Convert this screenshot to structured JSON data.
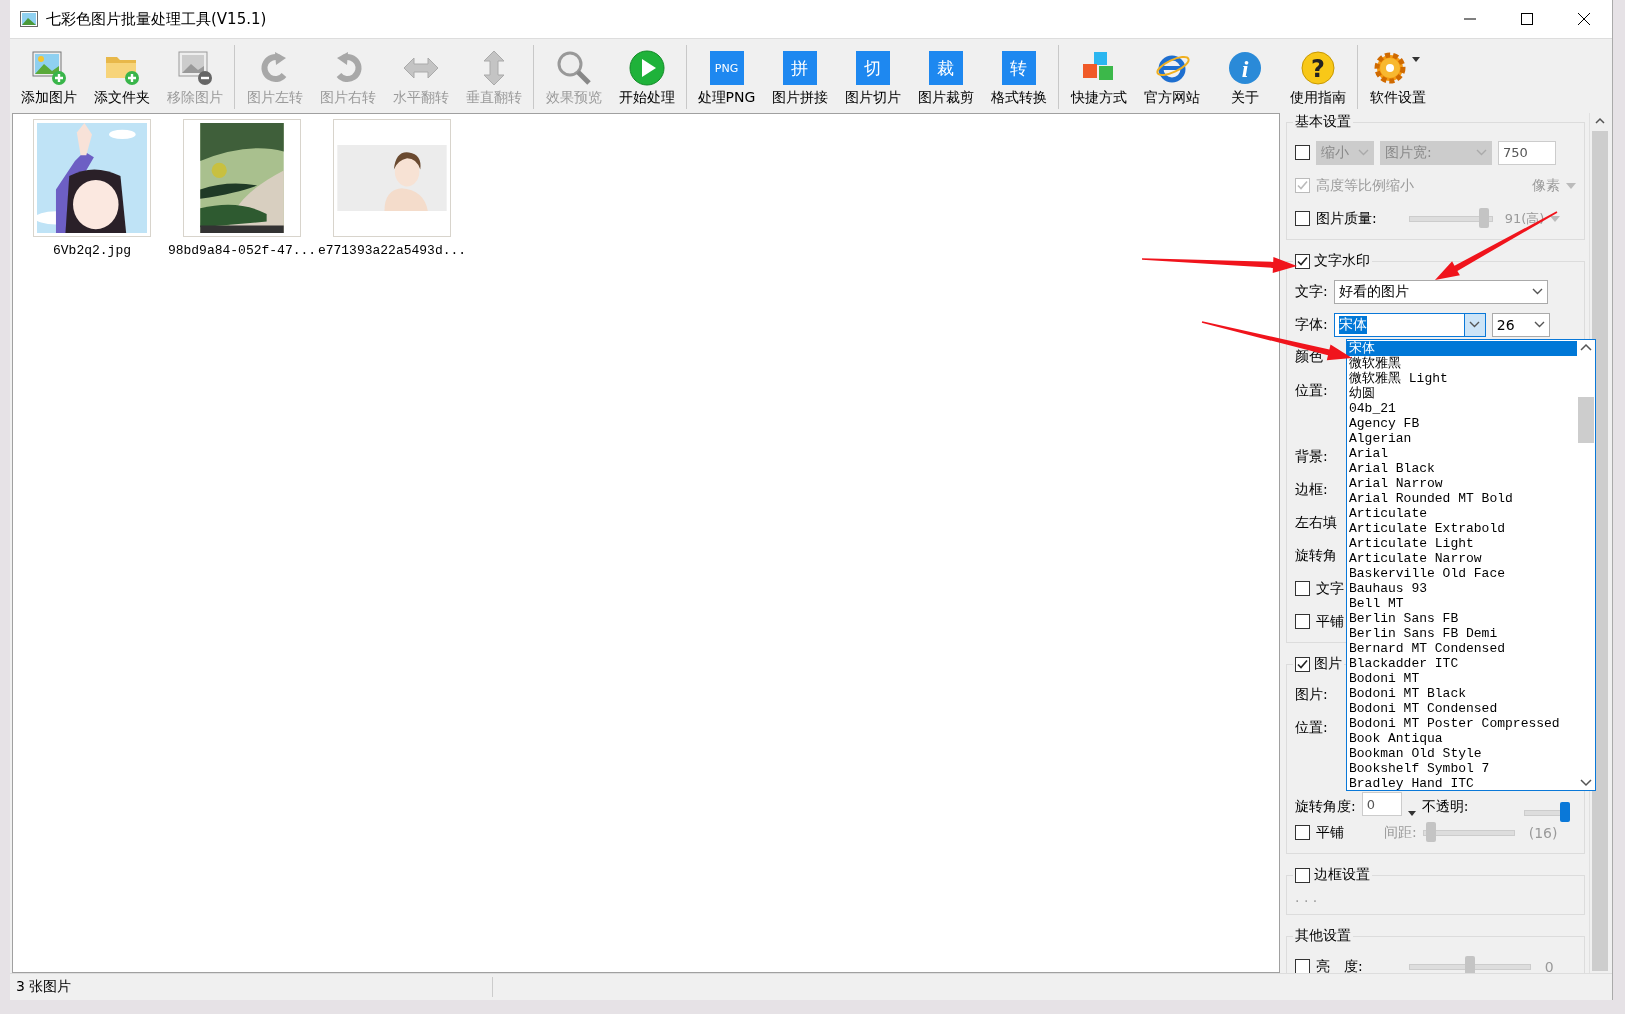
{
  "window": {
    "title": "七彩色图片批量处理工具(V15.1)"
  },
  "toolbar": {
    "groups": [
      {
        "items": [
          {
            "label": "添加图片",
            "disabled": false
          },
          {
            "label": "添文件夹",
            "disabled": false
          },
          {
            "label": "移除图片",
            "disabled": true
          }
        ]
      },
      {
        "items": [
          {
            "label": "图片左转",
            "disabled": true
          },
          {
            "label": "图片右转",
            "disabled": true
          },
          {
            "label": "水平翻转",
            "disabled": true
          },
          {
            "label": "垂直翻转",
            "disabled": true
          }
        ]
      },
      {
        "items": [
          {
            "label": "效果预览",
            "disabled": true
          },
          {
            "label": "开始处理",
            "disabled": false
          }
        ]
      },
      {
        "items": [
          {
            "label": "处理PNG",
            "badge": "PNG",
            "disabled": false
          },
          {
            "label": "图片拼接",
            "badge": "拼",
            "disabled": false
          },
          {
            "label": "图片切片",
            "badge": "切",
            "disabled": false
          },
          {
            "label": "图片裁剪",
            "badge": "裁",
            "disabled": false
          },
          {
            "label": "格式转换",
            "badge": "转",
            "disabled": false
          }
        ]
      },
      {
        "items": [
          {
            "label": "快捷方式",
            "disabled": false
          },
          {
            "label": "官方网站",
            "disabled": false
          },
          {
            "label": "关于",
            "glyph": "i",
            "disabled": false
          },
          {
            "label": "使用指南",
            "glyph": "?",
            "disabled": false
          }
        ]
      },
      {
        "items": [
          {
            "label": "软件设置",
            "disabled": false
          }
        ]
      }
    ]
  },
  "images": [
    {
      "kind": "picture",
      "caption": "6Vb2q2.jpg"
    },
    {
      "kind": "picture",
      "caption": "98bd9a84-052f-47..."
    },
    {
      "kind": "picture",
      "caption": "e771393a22a5493d..."
    }
  ],
  "settings": {
    "basic": {
      "title": "基本设置",
      "resize": {
        "checked": false,
        "mode": "缩小",
        "dimension": "图片宽:",
        "value": "750"
      },
      "keep_ratio": {
        "label": "高度等比例缩小",
        "checked": true,
        "unit": "像素"
      },
      "quality": {
        "label": "图片质量:",
        "checked": false,
        "level": 0.9,
        "reading": "91(高)"
      }
    },
    "text_watermark": {
      "label": "文字水印",
      "checked": true,
      "text_label": "文字:",
      "text_value": "好看的图片",
      "font_label": "字体:",
      "font_value": "宋体",
      "size_value": "26",
      "labels": [
        "颜色",
        "位置:",
        "背景:",
        "边框:",
        "左右填",
        "旋转角"
      ],
      "options": [
        {
          "label": "文字",
          "checked": false
        },
        {
          "label": "平铺",
          "checked": false
        }
      ],
      "font_list": [
        {
          "label": "宋体",
          "selected": true
        },
        {
          "label": "微软雅黑",
          "selected": false
        },
        {
          "label": "微软雅黑 Light",
          "selected": false
        },
        {
          "label": "幼圆",
          "selected": false
        },
        {
          "label": "04b_21",
          "selected": false
        },
        {
          "label": "Agency FB",
          "selected": false
        },
        {
          "label": "Algerian",
          "selected": false
        },
        {
          "label": "Arial",
          "selected": false
        },
        {
          "label": "Arial Black",
          "selected": false
        },
        {
          "label": "Arial Narrow",
          "selected": false
        },
        {
          "label": "Arial Rounded MT Bold",
          "selected": false
        },
        {
          "label": "Articulate",
          "selected": false
        },
        {
          "label": "Articulate Extrabold",
          "selected": false
        },
        {
          "label": "Articulate Light",
          "selected": false
        },
        {
          "label": "Articulate Narrow",
          "selected": false
        },
        {
          "label": "Baskerville Old Face",
          "selected": false
        },
        {
          "label": "Bauhaus 93",
          "selected": false
        },
        {
          "label": "Bell MT",
          "selected": false
        },
        {
          "label": "Berlin Sans FB",
          "selected": false
        },
        {
          "label": "Berlin Sans FB Demi",
          "selected": false
        },
        {
          "label": "Bernard MT Condensed",
          "selected": false
        },
        {
          "label": "Blackadder ITC",
          "selected": false
        },
        {
          "label": "Bodoni MT",
          "selected": false
        },
        {
          "label": "Bodoni MT Black",
          "selected": false
        },
        {
          "label": "Bodoni MT Condensed",
          "selected": false
        },
        {
          "label": "Bodoni MT Poster Compressed",
          "selected": false
        },
        {
          "label": "Book Antiqua",
          "selected": false
        },
        {
          "label": "Bookman Old Style",
          "selected": false
        },
        {
          "label": "Bookshelf Symbol 7",
          "selected": false
        },
        {
          "label": "Bradley Hand ITC",
          "selected": false
        }
      ]
    },
    "image_watermark": {
      "label": "图片",
      "checked": true,
      "labels": [
        "图片:",
        "位置:"
      ],
      "rotation_label": "旋转角度:",
      "rotation_value": "0",
      "opacity": {
        "label": "不透明:",
        "level": 1
      },
      "tile": {
        "label": "平铺",
        "checked": false,
        "spacing_label": "间距:",
        "level": 0.08,
        "reading": "(16)"
      }
    },
    "border": {
      "label": "边框设置",
      "checked": false,
      "hint": ". . ."
    },
    "other": {
      "title": "其他设置",
      "brightness": {
        "label": "亮　度:",
        "checked": false,
        "level": 0.5,
        "reading": "0"
      }
    }
  },
  "status_bar": {
    "text": "3 张图片"
  }
}
